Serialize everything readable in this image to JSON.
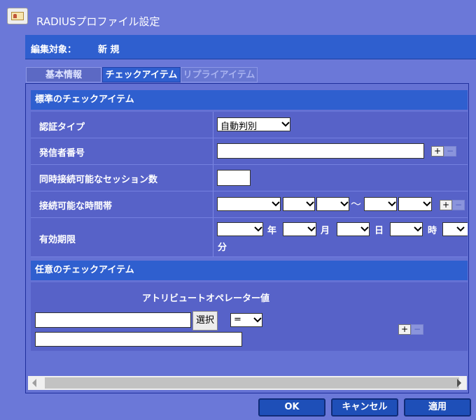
{
  "window": {
    "title": "RADIUSプロファイル設定",
    "icon": "profile-card-icon"
  },
  "edit_target": {
    "label": "編集対象：",
    "value": "新 規"
  },
  "tabs": [
    {
      "label": "基本情報",
      "active": false
    },
    {
      "label": "チェックアイテム",
      "active": true
    },
    {
      "label": "リプライアイテム",
      "active": false
    }
  ],
  "standard_section": {
    "title": "標準のチェックアイテム",
    "auth_type": {
      "label": "認証タイプ",
      "value": "自動判別"
    },
    "caller_id": {
      "label": "発信者番号",
      "value": ""
    },
    "sessions": {
      "label": "同時接続可能なセッション数",
      "value": ""
    },
    "time_range": {
      "label": "接続可能な時間帯",
      "separator": "〜"
    },
    "expiry": {
      "label": "有効期限",
      "units": {
        "year": "年",
        "month": "月",
        "day": "日",
        "hour": "時",
        "minute": "分"
      }
    },
    "plus": "+",
    "minus": "−"
  },
  "optional_section": {
    "title": "任意のチェックアイテム",
    "header": "アトリビュートオペレーター値",
    "select_button": "選択",
    "operator": "=",
    "attribute_value": "",
    "value": ""
  },
  "footer": {
    "ok": "OK",
    "cancel": "キャンセル",
    "apply": "適用"
  },
  "colors": {
    "background": "#6b78d8",
    "section_header": "#2f5fcf",
    "row": "#5762c8",
    "button": "#1e4fb8"
  }
}
